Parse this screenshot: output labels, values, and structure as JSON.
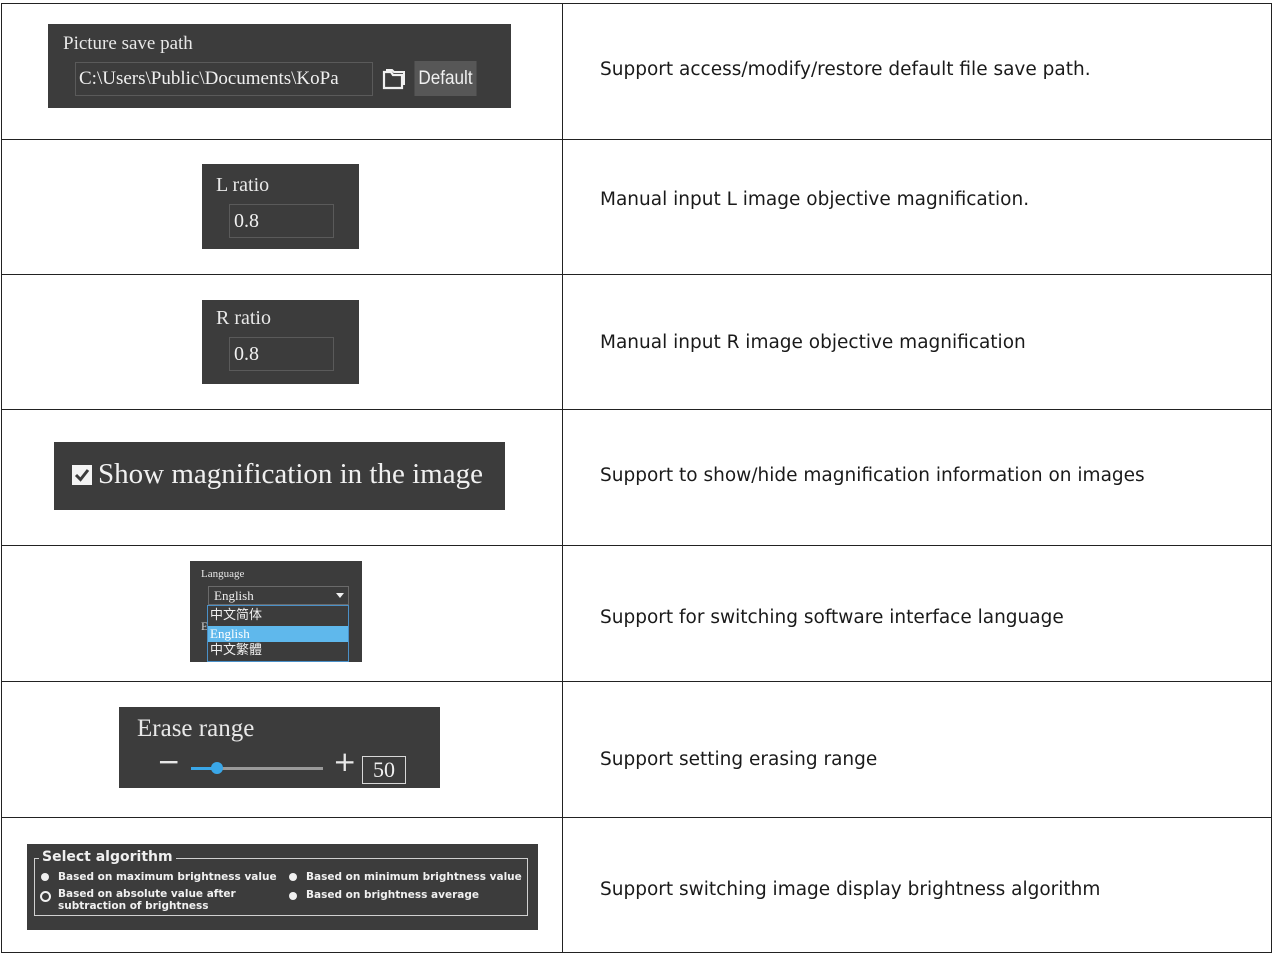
{
  "rows": [
    {
      "save_path": {
        "label": "Picture save path",
        "value": "C:\\Users\\Public\\Documents\\KoPa",
        "folder_icon": "folder-open-icon",
        "default_button": "Default"
      },
      "description": "Support access/modify/restore default file save path."
    },
    {
      "l_ratio": {
        "label": "L ratio",
        "value": "0.8"
      },
      "description": "Manual input L image objective magnification."
    },
    {
      "r_ratio": {
        "label": "R ratio",
        "value": "0.8"
      },
      "description": "Manual input R image objective magnification"
    },
    {
      "show_magnification": {
        "label": "Show magnification in the image",
        "checked": true
      },
      "description": "Support to show/hide magnification information on images"
    },
    {
      "language": {
        "label": "Language",
        "selected": "English",
        "options": [
          "中文简体",
          "English",
          "中文繁體"
        ],
        "highlighted": "English",
        "hidden_letter": "E"
      },
      "description": "Support for switching software interface language"
    },
    {
      "erase_range": {
        "label": "Erase range",
        "minus": "−",
        "plus": "+",
        "value": "50",
        "slider_fraction": 0.2
      },
      "description": "Support setting erasing range"
    },
    {
      "algorithm": {
        "legend": "Select algorithm",
        "options": [
          "Based on maximum brightness value",
          "Based on minimum brightness value",
          "Based on absolute value after",
          "subtraction of brightness",
          "Based on brightness average"
        ],
        "selected": "Based on absolute value after subtraction of brightness"
      },
      "description": "Support switching image display brightness algorithm"
    }
  ],
  "colors": {
    "panel_bg": "#3c3c3c",
    "highlight": "#5fb8ec",
    "slider_thumb": "#3aa7e8",
    "border": "#222222"
  }
}
